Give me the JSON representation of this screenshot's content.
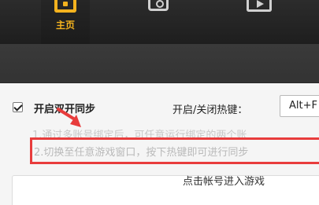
{
  "nav": {
    "home_label": "主页",
    "home_icon": "home-icon",
    "icon2": "tab-icon",
    "icon3": "video-icon",
    "active_color": "#f3b21e"
  },
  "sync": {
    "checked": true,
    "label": "开启双开同步"
  },
  "hotkey": {
    "label": "开启/关闭热键：",
    "value": "Alt+F"
  },
  "tips": {
    "line1": "1.通过多账号绑定后，可任意运行绑定的两个账",
    "line2": "2.切换至任意游戏窗口，按下热键即可进行同步"
  },
  "account": {
    "enter_label": "点击帐号进入游戏"
  },
  "annotation": {
    "color": "#e83c3c"
  }
}
